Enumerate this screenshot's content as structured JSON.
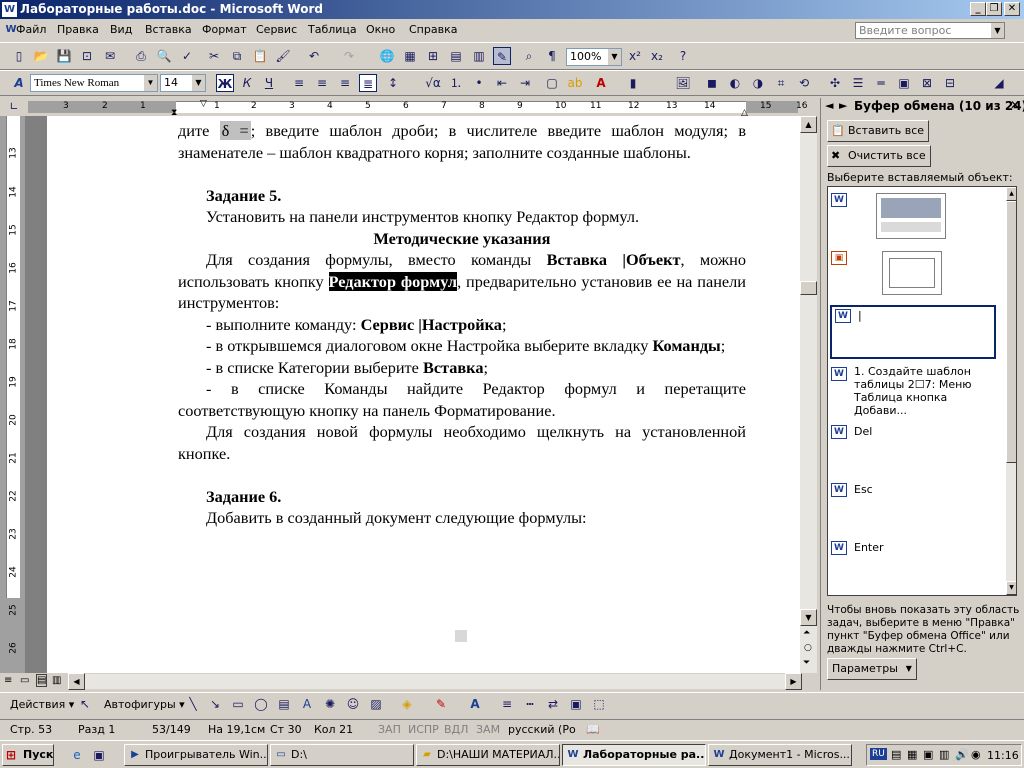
{
  "window": {
    "title": "Лабораторные работы.doc - Microsoft Word",
    "min": "_",
    "max": "❐",
    "close": "✕"
  },
  "menu": {
    "items": [
      "Файл",
      "Правка",
      "Вид",
      "Вставка",
      "Формат",
      "Сервис",
      "Таблица",
      "Окно",
      "Справка"
    ],
    "help_placeholder": "Введите вопрос"
  },
  "formatting": {
    "font": "Times New Roman",
    "size": "14",
    "bold": "Ж",
    "italic": "К",
    "underline": "Ч"
  },
  "standard": {
    "zoom": "100%"
  },
  "ruler": {
    "numbers": [
      "3",
      "2",
      "1",
      "1",
      "2",
      "3",
      "4",
      "5",
      "6",
      "7",
      "8",
      "9",
      "10",
      "11",
      "12",
      "13",
      "14",
      "15",
      "16"
    ]
  },
  "vruler": {
    "numbers": [
      "13",
      "14",
      "15",
      "16",
      "17",
      "18",
      "19",
      "20",
      "21",
      "22",
      "23",
      "24",
      "25",
      "26"
    ]
  },
  "doc": {
    "l1a": "дите",
    "l1b": "δ =",
    "l1c": "; введите шаблон дроби; в числителе введите шаблон модуля; в знаменателе – шаблон квадратного корня; заполните созданные шаблоны.",
    "task5": "Задание 5.",
    "task5_text": "Установить на панели инструментов кнопку Редактор формул.",
    "method": "Методические указания",
    "p1a": "Для создания формулы, вместо команды ",
    "p1b": "Вставка |Объект",
    "p1c": ", можно использовать кнопку ",
    "p1d": "Редактор формул",
    "p1e": ", предварительно установив ее на панели инструментов:",
    "b1a": "-   выполните команду: ",
    "b1b": "Сервис |Настройка",
    "b1c": ";",
    "b2a": "-   в открывшемся диалоговом окне Настройка выберите вкладку ",
    "b2b": "Команды",
    "b2c": ";",
    "b3a": "-   в списке Категории выберите ",
    "b3b": "Вставка",
    "b3c": ";",
    "b4": "-   в списке Команды найдите Редактор формул и перетащите соответствующую кнопку на панель Форматирование.",
    "p2": "Для создания новой формулы необходимо щелкнуть на установленной кнопке.",
    "task6": "Задание 6.",
    "task6_text": "Добавить в созданный документ следующие формулы:"
  },
  "taskpane": {
    "title": "Буфер обмена (10 из 24)",
    "paste_all": "Вставить все",
    "clear_all": "Очистить все",
    "choose": "Выберите вставляемый объект:",
    "cursor": "|",
    "item4": "1. Создайте шаблон таблицы 2☐7: Меню Таблица кнопка Добави...",
    "item5": "Del",
    "item6": "Esc",
    "item7": "Enter",
    "hint": "Чтобы вновь показать эту область задач, выберите в меню \"Правка\" пункт \"Буфер обмена Office\" или дважды нажмите Ctrl+C.",
    "params": "Параметры"
  },
  "drawbar": {
    "actions": "Действия",
    "autoshapes": "Автофигуры"
  },
  "status": {
    "page": "Стр.  53",
    "section": "Разд  1",
    "pages": "53/149",
    "at": "На 19,1см",
    "line": "Ст  30",
    "col": "Кол  21",
    "rec": "ЗАП",
    "trk": "ИСПР",
    "ext": "ВДЛ",
    "ovr": "ЗАМ",
    "lang": "русский (Ро"
  },
  "taskbar": {
    "start": "Пуск",
    "tasks": [
      "Проигрыватель Win...",
      "D:\\",
      "D:\\НАШИ МАТЕРИАЛ...",
      "Лабораторные ра...",
      "Документ1 - Micros..."
    ],
    "lang": "RU",
    "clock": "11:16"
  }
}
